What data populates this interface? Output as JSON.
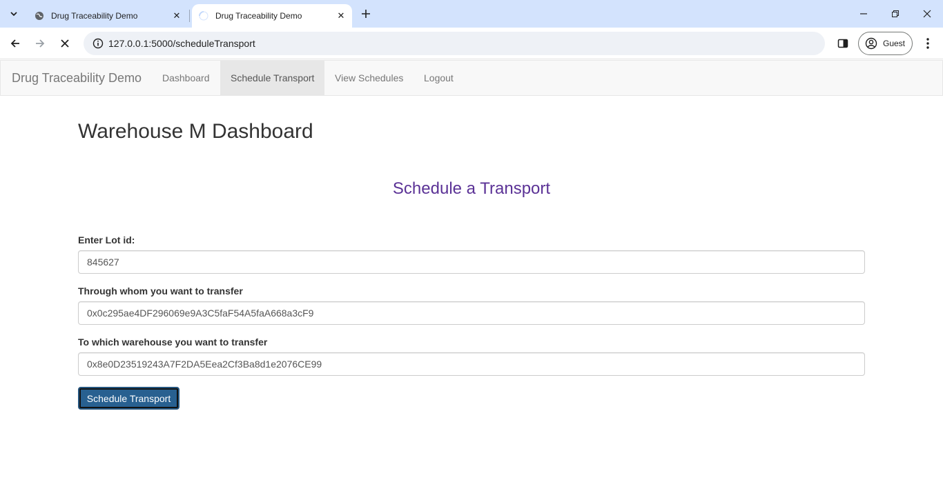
{
  "browser": {
    "tabs": [
      {
        "title": "Drug Traceability Demo",
        "state": "loaded"
      },
      {
        "title": "Drug Traceability Demo",
        "state": "loading"
      }
    ],
    "url": "127.0.0.1:5000/scheduleTransport",
    "profile_label": "Guest"
  },
  "navbar": {
    "brand": "Drug Traceability Demo",
    "items": [
      {
        "label": "Dashboard",
        "active": false
      },
      {
        "label": "Schedule Transport",
        "active": true
      },
      {
        "label": "View Schedules",
        "active": false
      },
      {
        "label": "Logout",
        "active": false
      }
    ]
  },
  "main": {
    "title": "Warehouse M Dashboard",
    "section_title": "Schedule a Transport",
    "form": {
      "lot_label": "Enter Lot id:",
      "lot_value": "845627",
      "through_label": "Through whom you want to transfer",
      "through_value": "0x0c295ae4DF296069e9A3C5faF54A5faA668a3cF9",
      "warehouse_label": "To which warehouse you want to transfer",
      "warehouse_value": "0x8e0D23519243A7F2DA5Eea2Cf3Ba8d1e2076CE99",
      "submit_label": "Schedule Transport"
    }
  },
  "colors": {
    "section_title": "#5b3296",
    "primary_button": "#286090",
    "navbar_bg": "#f8f8f8",
    "tabstrip_bg": "#d3e3fd"
  }
}
